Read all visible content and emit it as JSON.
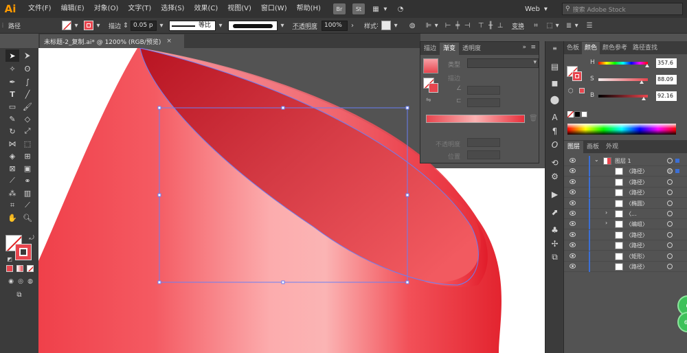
{
  "app": {
    "logo": "Ai"
  },
  "menu": [
    "文件(F)",
    "编辑(E)",
    "对象(O)",
    "文字(T)",
    "选择(S)",
    "效果(C)",
    "视图(V)",
    "窗口(W)",
    "帮助(H)"
  ],
  "app_buttons": [
    "Br",
    "St"
  ],
  "workspace": {
    "label": "Web"
  },
  "stock_search": {
    "placeholder": "搜索 Adobe Stock"
  },
  "control_bar": {
    "selection_label": "路径",
    "stroke_label": "描边",
    "stroke_value": "0.05 p",
    "stroke_profile": "等比",
    "opacity_label": "不透明度",
    "opacity_value": "100%",
    "style_label": "样式",
    "transform_label": "变换"
  },
  "document": {
    "tab_title": "未标题-2_复制.ai* @ 1200% (RGB/预览)"
  },
  "gradient_panel": {
    "tabs": [
      "描边",
      "渐变",
      "透明度"
    ],
    "active_tab": "渐变",
    "type_label": "类型",
    "stroke_label": "描边",
    "opacity_label": "不透明度",
    "location_label": "位置",
    "bar_colors": [
      "#e8454e",
      "#fbb3b3",
      "#e9303c"
    ]
  },
  "color_panel": {
    "tabs": [
      "色板",
      "颜色",
      "颜色参考",
      "路径查找"
    ],
    "active_tab": "颜色",
    "sliders": [
      {
        "label": "H",
        "value": "357.6",
        "level": 0.99
      },
      {
        "label": "S",
        "value": "88.09",
        "level": 0.88
      },
      {
        "label": "B",
        "value": "92.16",
        "level": 0.92
      }
    ]
  },
  "layers_panel": {
    "tabs": [
      "图层",
      "画板",
      "外观"
    ],
    "active_tab": "图层",
    "layer_name": "图层 1",
    "items": [
      "〈路径〉",
      "〈路径〉",
      "〈路径〉",
      "〈椭圆〉",
      "〈...",
      "〈编组〉",
      "〈路径〉",
      "〈路径〉",
      "〈矩形〉",
      "〈路径〉"
    ]
  },
  "colors": {
    "accent_red": "#e8454e",
    "selection_blue": "#6a7ff5",
    "layer_blue": "#3b6fd6"
  },
  "badges": [
    "6",
    "64"
  ]
}
